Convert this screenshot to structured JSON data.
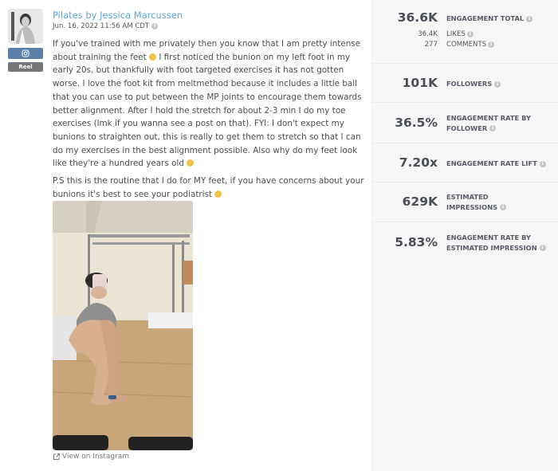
{
  "post": {
    "author": "Pilates by Jessica Marcussen",
    "timestamp": "Jun. 16, 2022 11:56 AM CDT",
    "platform_icon": "instagram-icon",
    "platform_color": "#5a7fa8",
    "type_badge": "Reel",
    "caption_paragraphs": [
      [
        "If you've trained with me privately then you know that I am pretty intense about training the feet ",
        " I first noticed the bunion on my left foot in my early 20s, but thankfully with foot targeted exercises it has not gotten worse. I love the foot kit from meltmethod because it includes a little ball that you can use to put between the MP joints to encourage them towards better alignment. After I hold the stretch for about 2-3 min I do my toe exercises (lmk if you wanna see a post on that). FYI: I don't expect my bunions to straighten out, this is really to get them to stretch so that I can do my exercises in the best alignment possible. Also why do my feet look like they're a hundred years old ",
        ""
      ],
      [
        "P.S this is the routine that I do for MY feet, if you have concerns about your bunions it's best to see your podiatrist ",
        ""
      ]
    ],
    "view_link": "View on Instagram",
    "link_color": "#5ea4d9"
  },
  "stats": {
    "engagement_total": {
      "value": "36.6K",
      "label": "ENGAGEMENT TOTAL"
    },
    "likes": {
      "value": "36.4K",
      "label": "LIKES"
    },
    "comments": {
      "value": "277",
      "label": "COMMENTS"
    },
    "followers": {
      "value": "101K",
      "label": "FOLLOWERS"
    },
    "engagement_rate_follower": {
      "value": "36.5%",
      "label_line1": "ENGAGEMENT RATE BY",
      "label_line2": "FOLLOWER"
    },
    "engagement_rate_lift": {
      "value": "7.20x",
      "label": "ENGAGEMENT RATE LIFT"
    },
    "estimated_impressions": {
      "value": "629K",
      "label_line1": "ESTIMATED",
      "label_line2": "IMPRESSIONS"
    },
    "engagement_rate_impression": {
      "value": "5.83%",
      "label_line1": "ENGAGEMENT RATE BY",
      "label_line2": "ESTIMATED IMPRESSION"
    }
  }
}
